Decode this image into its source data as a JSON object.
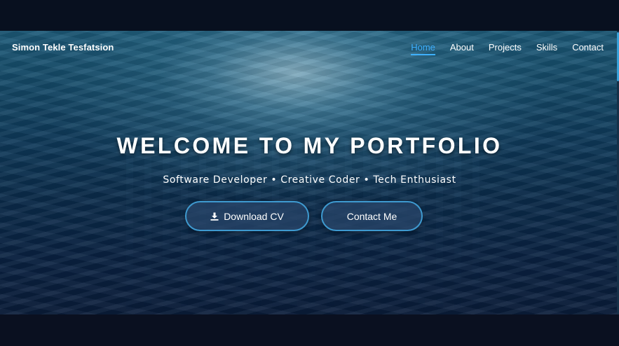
{
  "brand": {
    "name": "Simon Tekle Tesfatsion"
  },
  "nav": {
    "items": [
      {
        "label": "Home",
        "active": true
      },
      {
        "label": "About",
        "active": false
      },
      {
        "label": "Projects",
        "active": false
      },
      {
        "label": "Skills",
        "active": false
      },
      {
        "label": "Contact",
        "active": false
      }
    ]
  },
  "hero": {
    "headline": "WELCOME TO MY PORTFOLIO",
    "subtitle": "Software Developer • Creative Coder • Tech Enthusiast",
    "buttons": {
      "download_cv": {
        "label": "Download CV",
        "icon": "download-icon"
      },
      "contact_me": {
        "label": "Contact Me"
      }
    }
  },
  "colors": {
    "accent": "#3fb0ff",
    "button_border": "#3e9ad0",
    "background": "#0a1d3a"
  }
}
